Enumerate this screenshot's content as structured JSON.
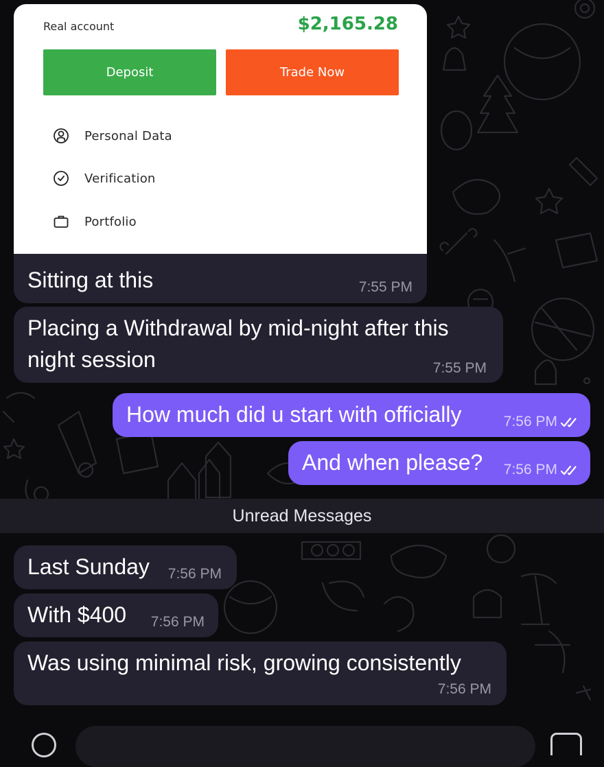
{
  "screenshot_card": {
    "account_label": "Real account",
    "balance": "$2,165.28",
    "deposit_label": "Deposit",
    "trade_label": "Trade Now",
    "menu": [
      {
        "label": "Personal Data",
        "icon": "user-circle-icon"
      },
      {
        "label": "Verification",
        "icon": "check-circle-icon"
      },
      {
        "label": "Portfolio",
        "icon": "briefcase-icon"
      }
    ],
    "colors": {
      "balance": "#2aa34a",
      "deposit": "#3aac4a",
      "trade": "#f8571f"
    }
  },
  "messages": [
    {
      "direction": "incoming",
      "text": "Sitting at this",
      "time": "7:55 PM"
    },
    {
      "direction": "incoming",
      "lines": [
        "Placing a Withdrawal by mid-night after this",
        "night session"
      ],
      "time": "7:55 PM"
    },
    {
      "direction": "outgoing",
      "text": "How much did u start with officially",
      "time": "7:56 PM",
      "status": "read"
    },
    {
      "direction": "outgoing",
      "text": "And when please?",
      "time": "7:56 PM",
      "status": "read"
    },
    {
      "direction": "incoming",
      "text": "Last Sunday",
      "time": "7:56 PM"
    },
    {
      "direction": "incoming",
      "text": "With $400",
      "time": "7:56 PM"
    },
    {
      "direction": "incoming",
      "text": "Was using minimal risk, growing consistently",
      "time": "7:56 PM"
    }
  ],
  "unread_divider": "Unread Messages",
  "colors": {
    "background": "#0b0b0d",
    "incoming_bubble": "#242130",
    "outgoing_bubble": "#7b5cf6"
  }
}
